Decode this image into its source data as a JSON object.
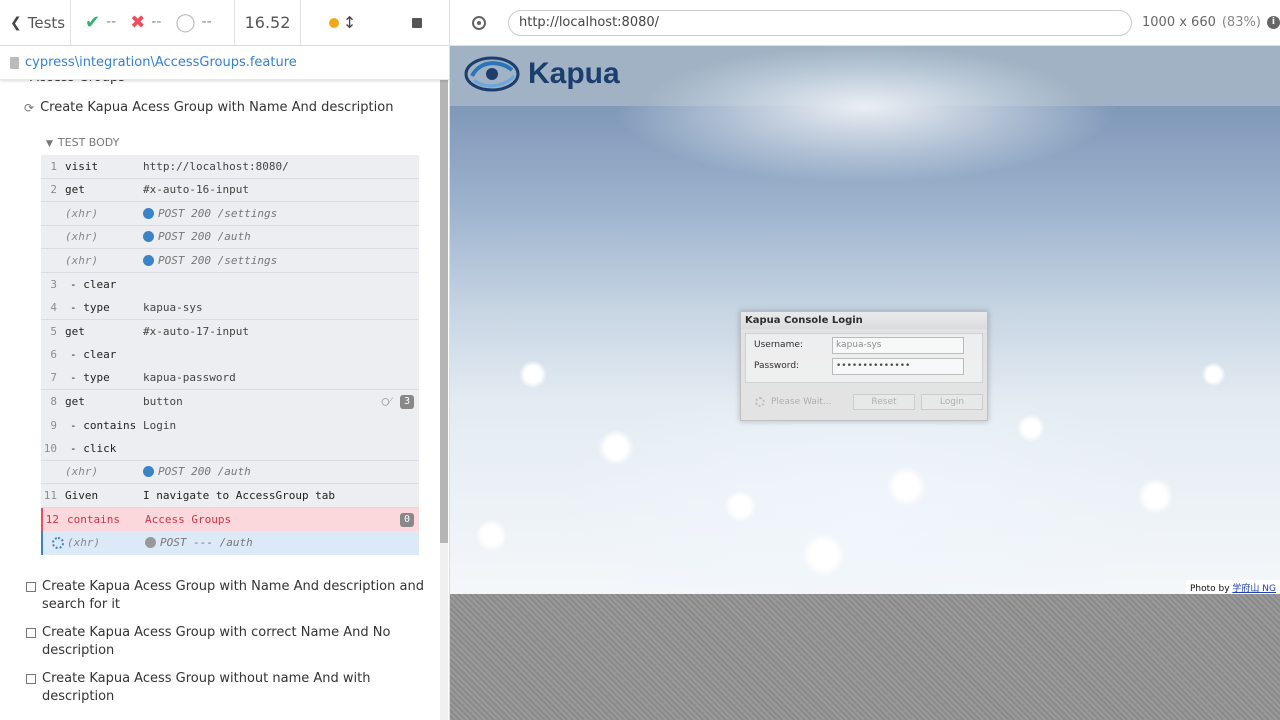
{
  "header": {
    "tests_label": "Tests",
    "passed": "--",
    "failed": "--",
    "pending": "--",
    "duration": "16.52"
  },
  "spec_path": "cypress\\integration\\AccessGroups.feature",
  "suite_title": "Access Groups",
  "current_test_title": "Create Kapua Acess Group with Name And description",
  "test_body_label": "TEST BODY",
  "commands": [
    {
      "num": "1",
      "name": "visit",
      "msg": "http://localhost:8080/"
    },
    {
      "num": "2",
      "name": "get",
      "msg": "#x-auto-16-input"
    },
    {
      "num": "",
      "name": "(xhr)",
      "msg": "POST 200 /settings"
    },
    {
      "num": "",
      "name": "(xhr)",
      "msg": "POST 200 /auth"
    },
    {
      "num": "",
      "name": "(xhr)",
      "msg": "POST 200 /settings"
    },
    {
      "num": "3",
      "name": "- clear",
      "msg": ""
    },
    {
      "num": "4",
      "name": "- type",
      "msg": "kapua-sys"
    },
    {
      "num": "5",
      "name": "get",
      "msg": "#x-auto-17-input"
    },
    {
      "num": "6",
      "name": "- clear",
      "msg": ""
    },
    {
      "num": "7",
      "name": "- type",
      "msg": "kapua-password"
    },
    {
      "num": "8",
      "name": "get",
      "msg": "button",
      "badge": "3"
    },
    {
      "num": "9",
      "name": "- contains",
      "msg": "Login"
    },
    {
      "num": "10",
      "name": "- click",
      "msg": ""
    },
    {
      "num": "",
      "name": "(xhr)",
      "msg": "POST 200 /auth"
    },
    {
      "num": "11",
      "name": "Given",
      "msg": "I navigate to AccessGroup tab"
    },
    {
      "num": "12",
      "name": "contains",
      "msg": "Access Groups",
      "badge": "0"
    },
    {
      "num": "",
      "name": "(xhr)",
      "msg": "POST --- /auth"
    }
  ],
  "pending_tests": [
    {
      "title": "Create Kapua Acess Group with Name And description and search for it"
    },
    {
      "title": "Create Kapua Acess Group with correct Name And No description"
    },
    {
      "title": "Create Kapua Acess Group without name And with description"
    }
  ],
  "aut": {
    "url": "http://localhost:8080/",
    "viewport": "1000 x 660",
    "scale": "(83%)",
    "brand": "Kapua",
    "photo_credit": "Photo by",
    "photo_credit_link": "学府山 NG"
  },
  "login": {
    "title": "Kapua Console Login",
    "username_label": "Username:",
    "username_value": "kapua-sys",
    "password_label": "Password:",
    "password_value": "••••••••••••••",
    "wait_label": "Please Wait...",
    "reset_label": "Reset",
    "login_label": "Login"
  },
  "colors": {
    "pass": "#2fb46b",
    "fail": "#e94f5f",
    "link": "#3380d6",
    "xhr_dot": "#3b83c6"
  }
}
